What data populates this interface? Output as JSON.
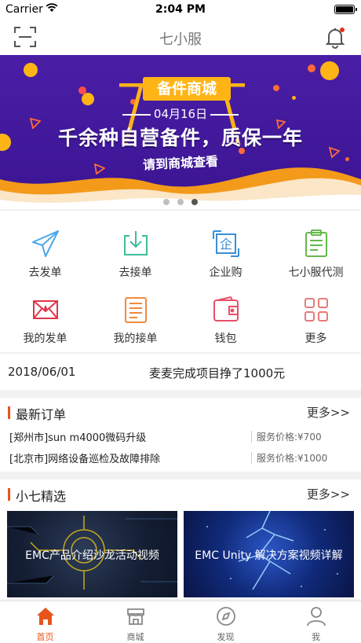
{
  "status_bar": {
    "carrier": "Carrier",
    "time": "2:04 PM"
  },
  "nav": {
    "title": "七小服",
    "left_icon": "scan-icon",
    "right_icon": "bell-icon",
    "badge_color": "#e8301c"
  },
  "banner": {
    "tag": "备件商城",
    "date": "04月16日",
    "headline": "千余种自营备件，质保一年",
    "sub": "请到商城查看",
    "page_count": 3,
    "active_page": 3
  },
  "quick_actions": [
    {
      "label": "去发单",
      "icon": "paper-plane-icon",
      "color": "#4aa8e8"
    },
    {
      "label": "去接单",
      "icon": "inbox-download-icon",
      "color": "#3cbf9a"
    },
    {
      "label": "企业购",
      "icon": "enterprise-icon",
      "color": "#3a8fd8"
    },
    {
      "label": "七小服代测",
      "icon": "clipboard-icon",
      "color": "#66b84a"
    },
    {
      "label": "我的发单",
      "icon": "envelope-icon",
      "color": "#e0344b"
    },
    {
      "label": "我的接单",
      "icon": "list-icon",
      "color": "#f08a3c"
    },
    {
      "label": "钱包",
      "icon": "wallet-icon",
      "color": "#e8506a"
    },
    {
      "label": "更多",
      "icon": "grid-icon",
      "color": "#e87a7a"
    }
  ],
  "notice": {
    "date": "2018/06/01",
    "message": "麦麦完成项目挣了1000元"
  },
  "orders": {
    "title": "最新订单",
    "more": "更多>>",
    "rows": [
      {
        "name": "[郑州市]sun m4000微码升级",
        "price": "服务价格:¥700"
      },
      {
        "name": "[北京市]网络设备巡检及故障排除",
        "price": "服务价格:¥1000"
      }
    ]
  },
  "picks": {
    "title": "小七精选",
    "more": "更多>>",
    "cards": [
      {
        "label": "EMC产品介绍沙龙活动视频"
      },
      {
        "label": "EMC Unity 解决方案视频详解"
      }
    ]
  },
  "tabs": [
    {
      "label": "首页",
      "icon": "home-icon",
      "active": true
    },
    {
      "label": "商城",
      "icon": "store-icon",
      "active": false
    },
    {
      "label": "发现",
      "icon": "compass-icon",
      "active": false
    },
    {
      "label": "我",
      "icon": "user-icon",
      "active": false
    }
  ],
  "colors": {
    "accent": "#e8541c",
    "banner_bg": "#3a1492",
    "banner_yellow": "#ffb416"
  }
}
